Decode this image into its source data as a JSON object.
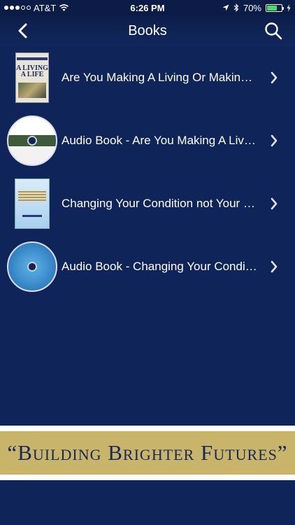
{
  "status": {
    "carrier": "AT&T",
    "time": "6:26 PM",
    "battery": "70%",
    "battery_level": 0.7,
    "icons": [
      "signal-dots-icon",
      "wifi-icon",
      "location-arrow-icon",
      "bluetooth-icon",
      "battery-icon",
      "charging-bolt-icon"
    ]
  },
  "nav": {
    "title": "Books",
    "icons": [
      "back-chevron-icon",
      "search-icon"
    ]
  },
  "books": [
    {
      "title": "Are You Making A Living Or Making A Life",
      "thumb": "book-cover",
      "cover_text": "A LIVING A LIFE"
    },
    {
      "title": "Audio Book - Are You Making A Living Or Making A Life",
      "thumb": "audio-disc",
      "cover_text": ""
    },
    {
      "title": "Changing Your Condition not Your Position",
      "thumb": "book-cover",
      "cover_text": ""
    },
    {
      "title": "Audio Book - Changing Your Condition not Your Position",
      "thumb": "audio-disc",
      "cover_text": ""
    }
  ],
  "banner": {
    "text": "“Building Brighter Futures”"
  },
  "colors": {
    "background": "#0f2458",
    "banner": "#c8b56a",
    "banner_text": "#16285e"
  }
}
